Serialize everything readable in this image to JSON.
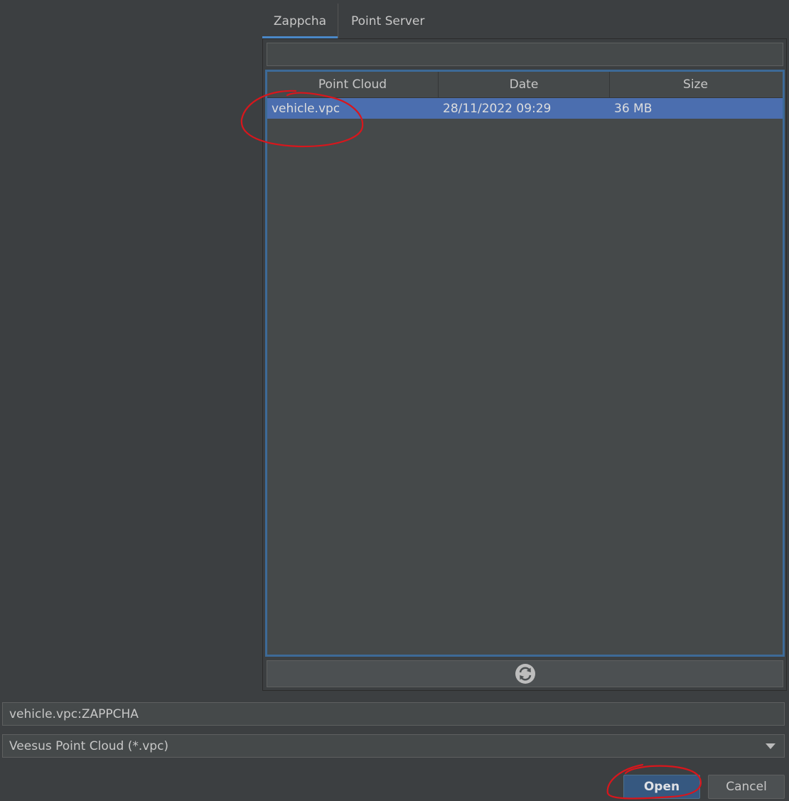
{
  "tabs": [
    {
      "label": "Zappcha",
      "active": true
    },
    {
      "label": "Point Server",
      "active": false
    }
  ],
  "search": {
    "value": "",
    "placeholder": ""
  },
  "table": {
    "columns": [
      "Point Cloud",
      "Date",
      "Size"
    ],
    "rows": [
      {
        "name": "vehicle.vpc",
        "date": "28/11/2022 09:29",
        "size": "36 MB",
        "selected": true
      }
    ]
  },
  "refresh": {
    "icon": "refresh-icon"
  },
  "path_field": {
    "value": "vehicle.vpc:ZAPPCHA"
  },
  "filter": {
    "selected": "Veesus Point Cloud (*.vpc)",
    "icon": "chevron-down-icon"
  },
  "buttons": {
    "open": "Open",
    "cancel": "Cancel"
  },
  "colors": {
    "background": "#3c3f41",
    "selection": "#4b6eaf",
    "tab_accent": "#4a88c7",
    "primary_button": "#365880",
    "annotation": "#d9161c"
  }
}
